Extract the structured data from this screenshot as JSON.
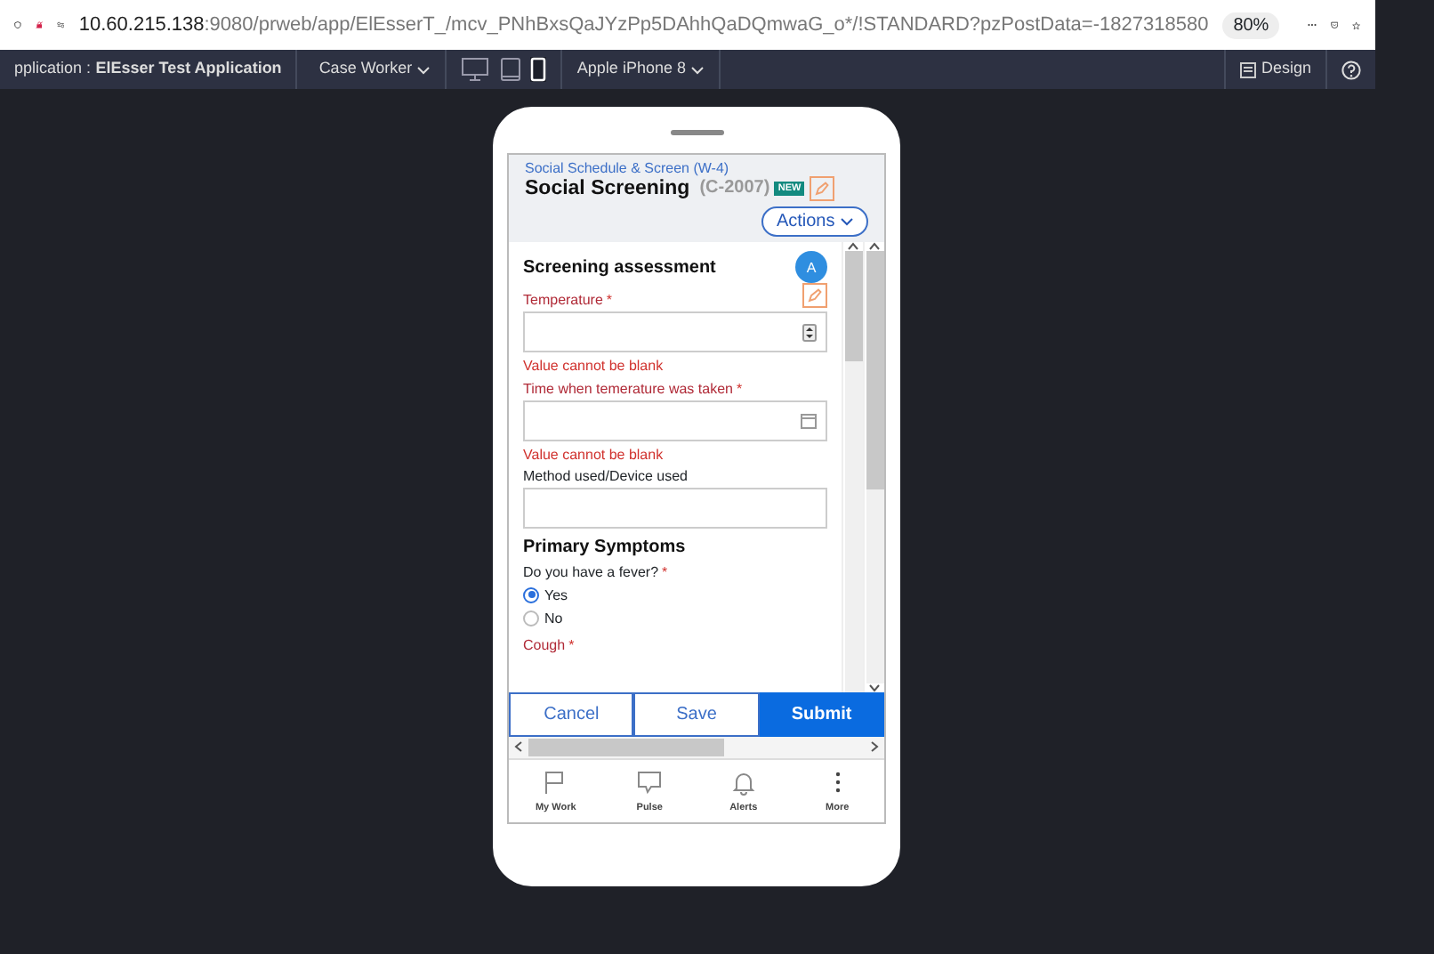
{
  "browser": {
    "url_host": "10.60.215.138",
    "url_rest": ":9080/prweb/app/ElEsserT_/mcv_PNhBxsQaJYzPp5DAhhQaDQmwaG_o*/!STANDARD?pzPostData=-1827318580",
    "zoom": "80%"
  },
  "app_bar": {
    "application_label": "pplication :",
    "application_name": "ElEsser Test Application",
    "portal": "Case Worker",
    "devices": [
      {
        "kind": "desktop",
        "selected": false
      },
      {
        "kind": "tablet",
        "selected": false
      },
      {
        "kind": "phone",
        "selected": true
      }
    ],
    "device_model": "Apple iPhone 8",
    "design": "Design"
  },
  "case": {
    "breadcrumb": "Social Schedule & Screen (W-4)",
    "title": "Social Screening",
    "case_id": "(C-2007)",
    "badge": "NEW",
    "actions": "Actions",
    "avatar": "A"
  },
  "form": {
    "section": "Screening assessment",
    "fields": [
      {
        "kind": "number",
        "label": "Temperature",
        "required_mark": "*",
        "error": "Value cannot be blank"
      },
      {
        "kind": "date",
        "label": "Time when temerature was taken",
        "required_mark": "*",
        "error": "Value cannot be blank"
      },
      {
        "kind": "text",
        "label": "Method used/Device used"
      }
    ],
    "symptoms_heading": "Primary Symptoms",
    "question": {
      "label": "Do you have a fever?",
      "required_mark": "*",
      "options": [
        {
          "label": "Yes",
          "selected": true
        },
        {
          "label": "No",
          "selected": false
        }
      ]
    },
    "next_label": {
      "label": "Cough",
      "required_mark": "*"
    }
  },
  "buttons": [
    {
      "kind": "secondary",
      "label": "Cancel"
    },
    {
      "kind": "secondary",
      "label": "Save"
    },
    {
      "kind": "primary",
      "label": "Submit"
    }
  ],
  "nav": [
    {
      "kind": "flag",
      "label": "My Work"
    },
    {
      "kind": "chat",
      "label": "Pulse"
    },
    {
      "kind": "bell",
      "label": "Alerts"
    },
    {
      "kind": "dots",
      "label": "More"
    }
  ]
}
